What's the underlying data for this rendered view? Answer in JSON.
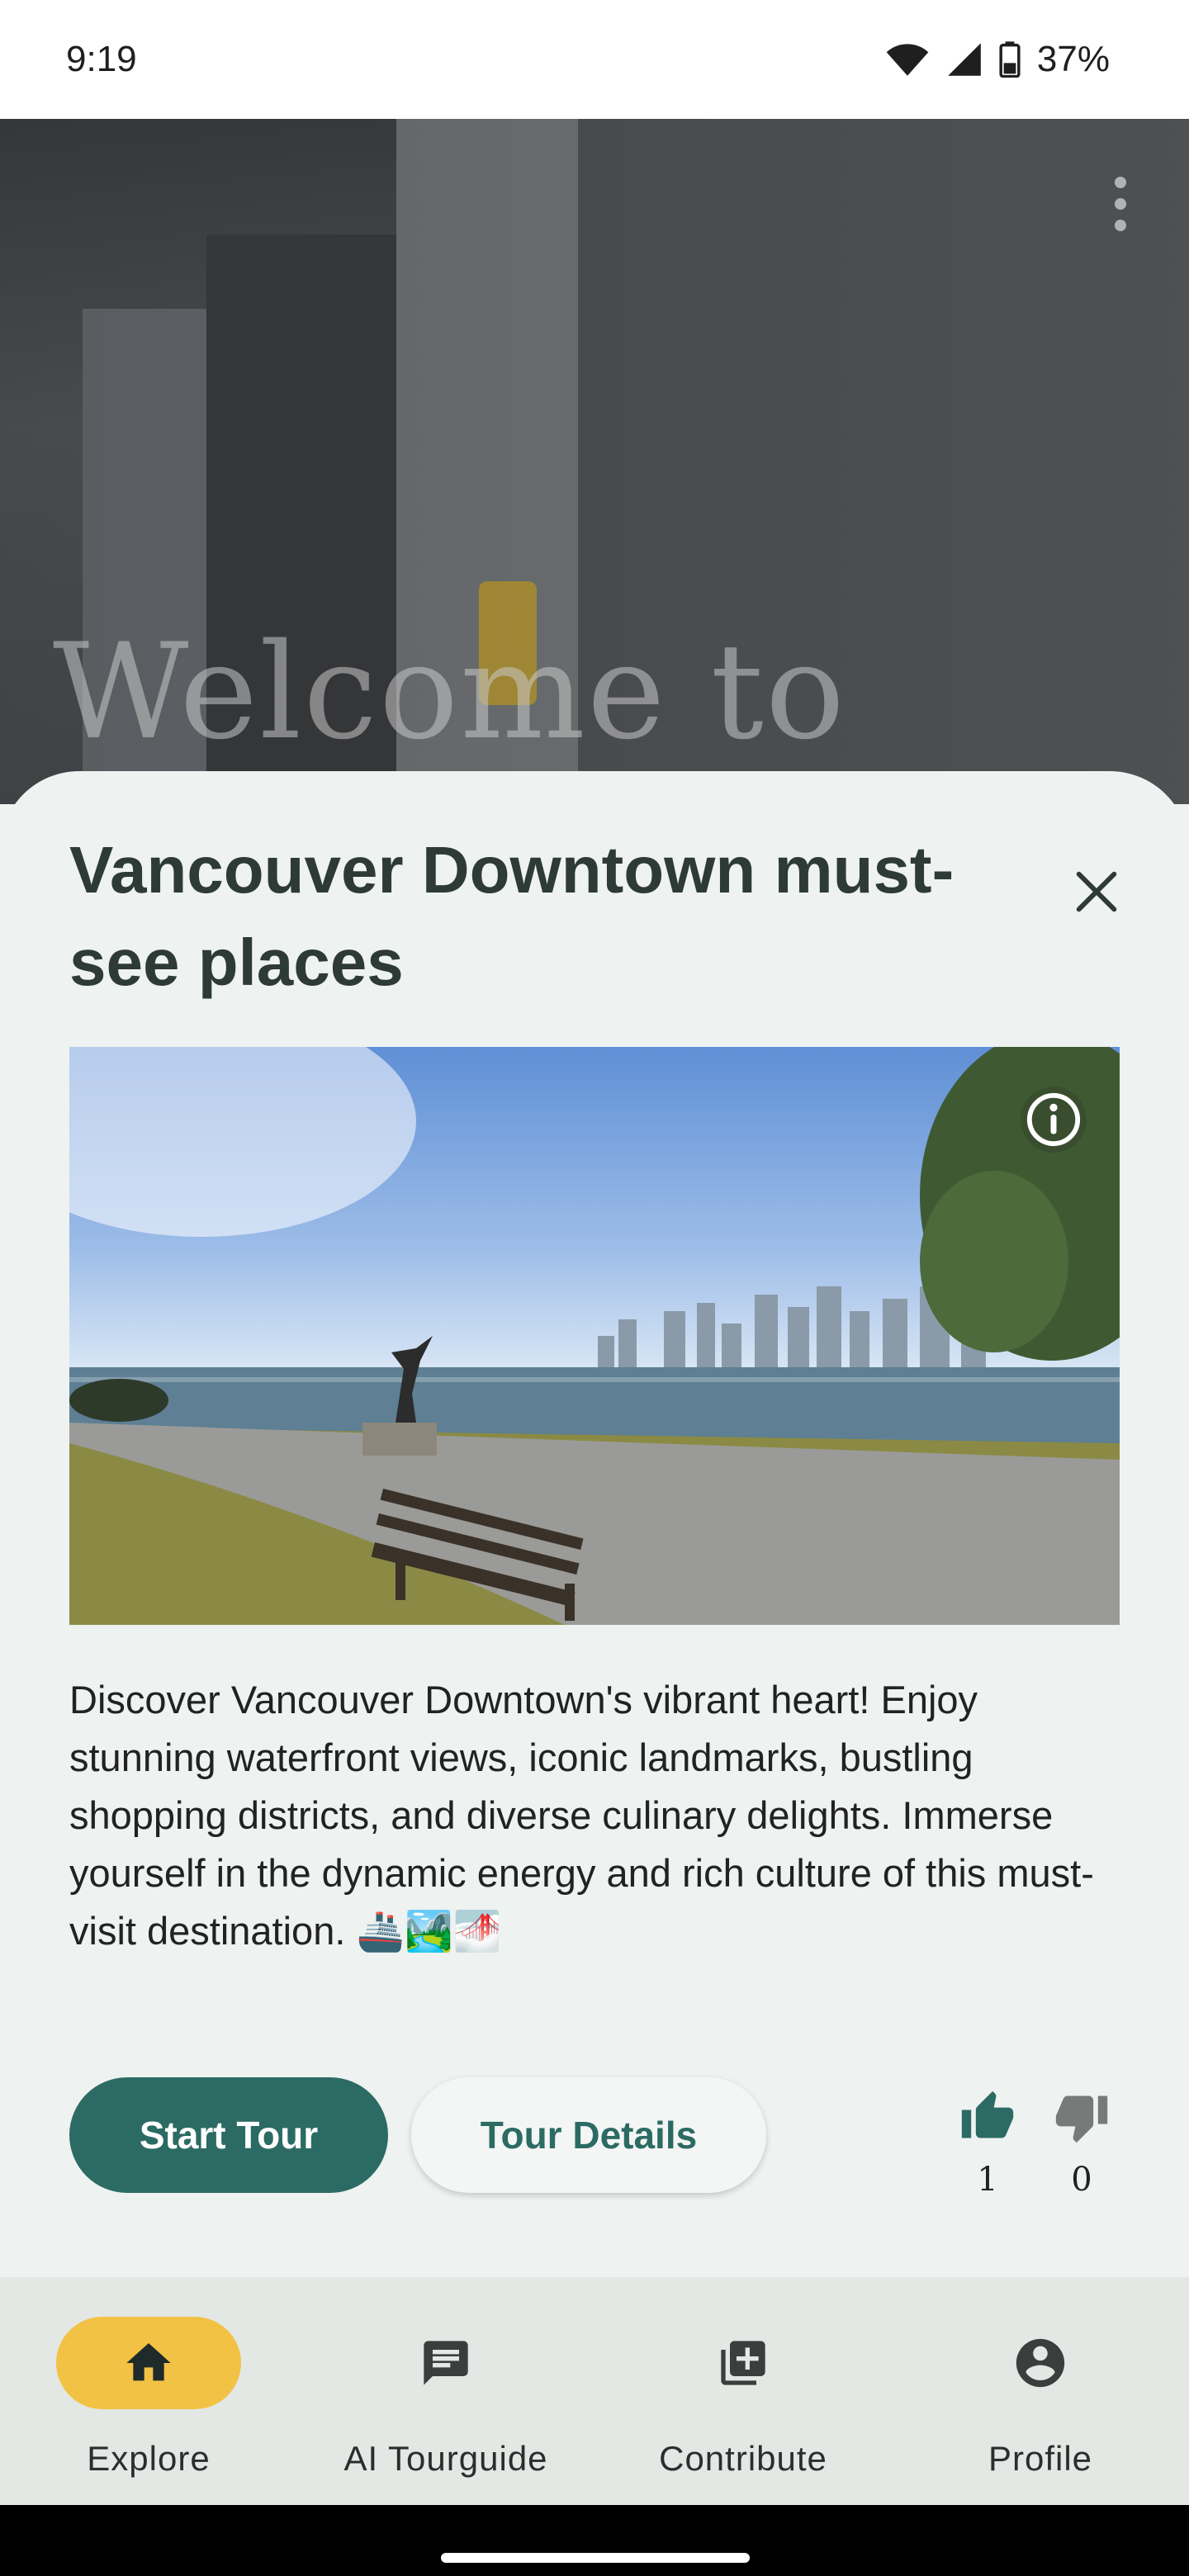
{
  "status_bar": {
    "time": "9:19",
    "battery": "37%"
  },
  "hero": {
    "welcome_text": "Welcome to"
  },
  "tour": {
    "title": "Vancouver Downtown must-see places",
    "description": "Discover Vancouver Downtown's vibrant heart! Enjoy stunning waterfront views, iconic landmarks, bustling shopping districts, and diverse culinary delights. Immerse yourself in the dynamic energy and rich culture of this must-visit destination. 🚢🏞️🌁",
    "start_label": "Start Tour",
    "details_label": "Tour Details",
    "likes": "1",
    "dislikes": "0"
  },
  "nav": {
    "items": [
      {
        "label": "Explore",
        "icon": "home-icon",
        "active": true
      },
      {
        "label": "AI Tourguide",
        "icon": "chat-icon",
        "active": false
      },
      {
        "label": "Contribute",
        "icon": "add-box-icon",
        "active": false
      },
      {
        "label": "Profile",
        "icon": "account-icon",
        "active": false
      }
    ]
  },
  "colors": {
    "primary": "#2b6b63",
    "accent": "#f2c245",
    "sheet_bg": "#eef2f0",
    "nav_bg": "#e3e8e5"
  }
}
